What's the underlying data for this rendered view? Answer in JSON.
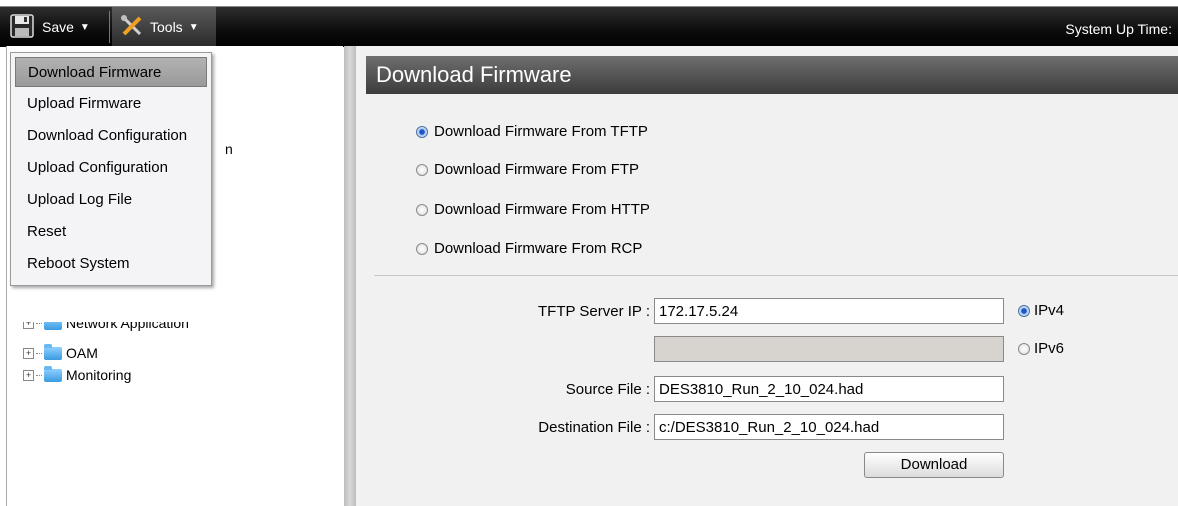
{
  "toolbar": {
    "save_label": "Save",
    "tools_label": "Tools",
    "uptime_label": "System Up Time:"
  },
  "tools_menu": {
    "items": [
      {
        "label": "Download Firmware",
        "active": true
      },
      {
        "label": "Upload Firmware"
      },
      {
        "label": "Download Configuration"
      },
      {
        "label": "Upload Configuration"
      },
      {
        "label": "Upload Log File"
      },
      {
        "label": "Reset"
      },
      {
        "label": "Reboot System"
      }
    ]
  },
  "tree": {
    "partial_item": "Network Application",
    "items": [
      {
        "label": "OAM"
      },
      {
        "label": "Monitoring"
      }
    ],
    "truncated_text": "n"
  },
  "main": {
    "title": "Download Firmware",
    "options": [
      {
        "label": "Download Firmware From TFTP",
        "selected": true
      },
      {
        "label": "Download Firmware From FTP",
        "selected": false
      },
      {
        "label": "Download Firmware From HTTP",
        "selected": false
      },
      {
        "label": "Download Firmware From RCP",
        "selected": false
      }
    ],
    "form": {
      "server_ip_label": "TFTP Server IP :",
      "server_ip_value": "172.17.5.24",
      "ipv4_label": "IPv4",
      "ipv6_label": "IPv6",
      "ipv6_value": "",
      "source_label": "Source File :",
      "source_value": "DES3810_Run_2_10_024.had",
      "dest_label": "Destination File :",
      "dest_value": "c:/DES3810_Run_2_10_024.had",
      "download_button": "Download"
    }
  }
}
